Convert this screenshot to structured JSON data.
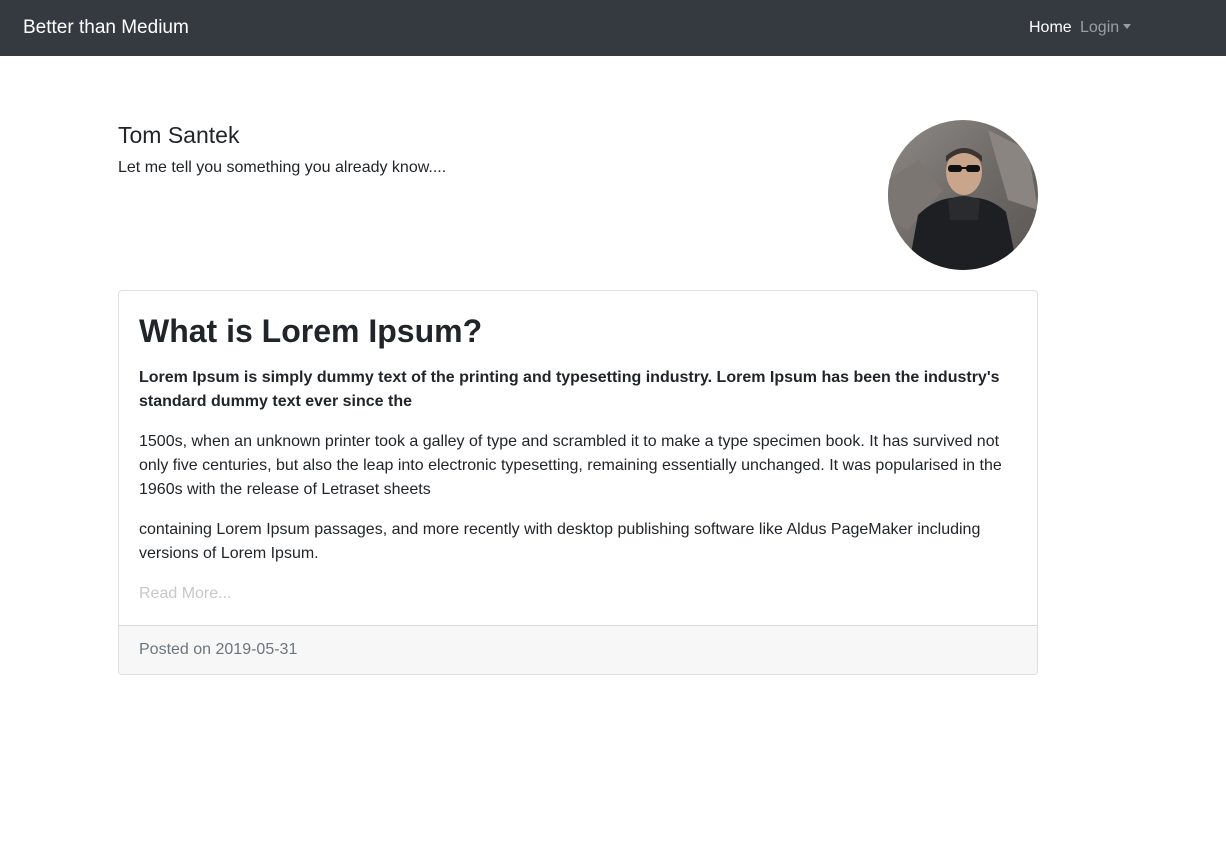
{
  "navbar": {
    "brand": "Better than Medium",
    "home_label": "Home",
    "login_label": "Login"
  },
  "author": {
    "name": "Tom Santek",
    "tagline": "Let me tell you something you already know...."
  },
  "post": {
    "title": "What is Lorem Ipsum?",
    "lead": "Lorem Ipsum is simply dummy text of the printing and typesetting industry. Lorem Ipsum has been the industry's standard dummy text ever since the",
    "paragraph_1": "1500s, when an unknown printer took a galley of type and scrambled it to make a type specimen book. It has survived not only five centuries, but also the leap into electronic typesetting, remaining essentially unchanged. It was popularised in the 1960s with the release of Letraset sheets",
    "paragraph_2": "containing Lorem Ipsum passages, and more recently with desktop publishing software like Aldus PageMaker including versions of Lorem Ipsum.",
    "read_more": "Read More...",
    "posted_on": "Posted on 2019-05-31"
  },
  "icons": {
    "login_dropdown": "caret-down-icon",
    "avatar": "user-avatar-photo"
  },
  "colors": {
    "navbar_bg": "#343a40",
    "card_footer_bg": "#f7f7f7",
    "read_more": "#c6c8ca"
  }
}
